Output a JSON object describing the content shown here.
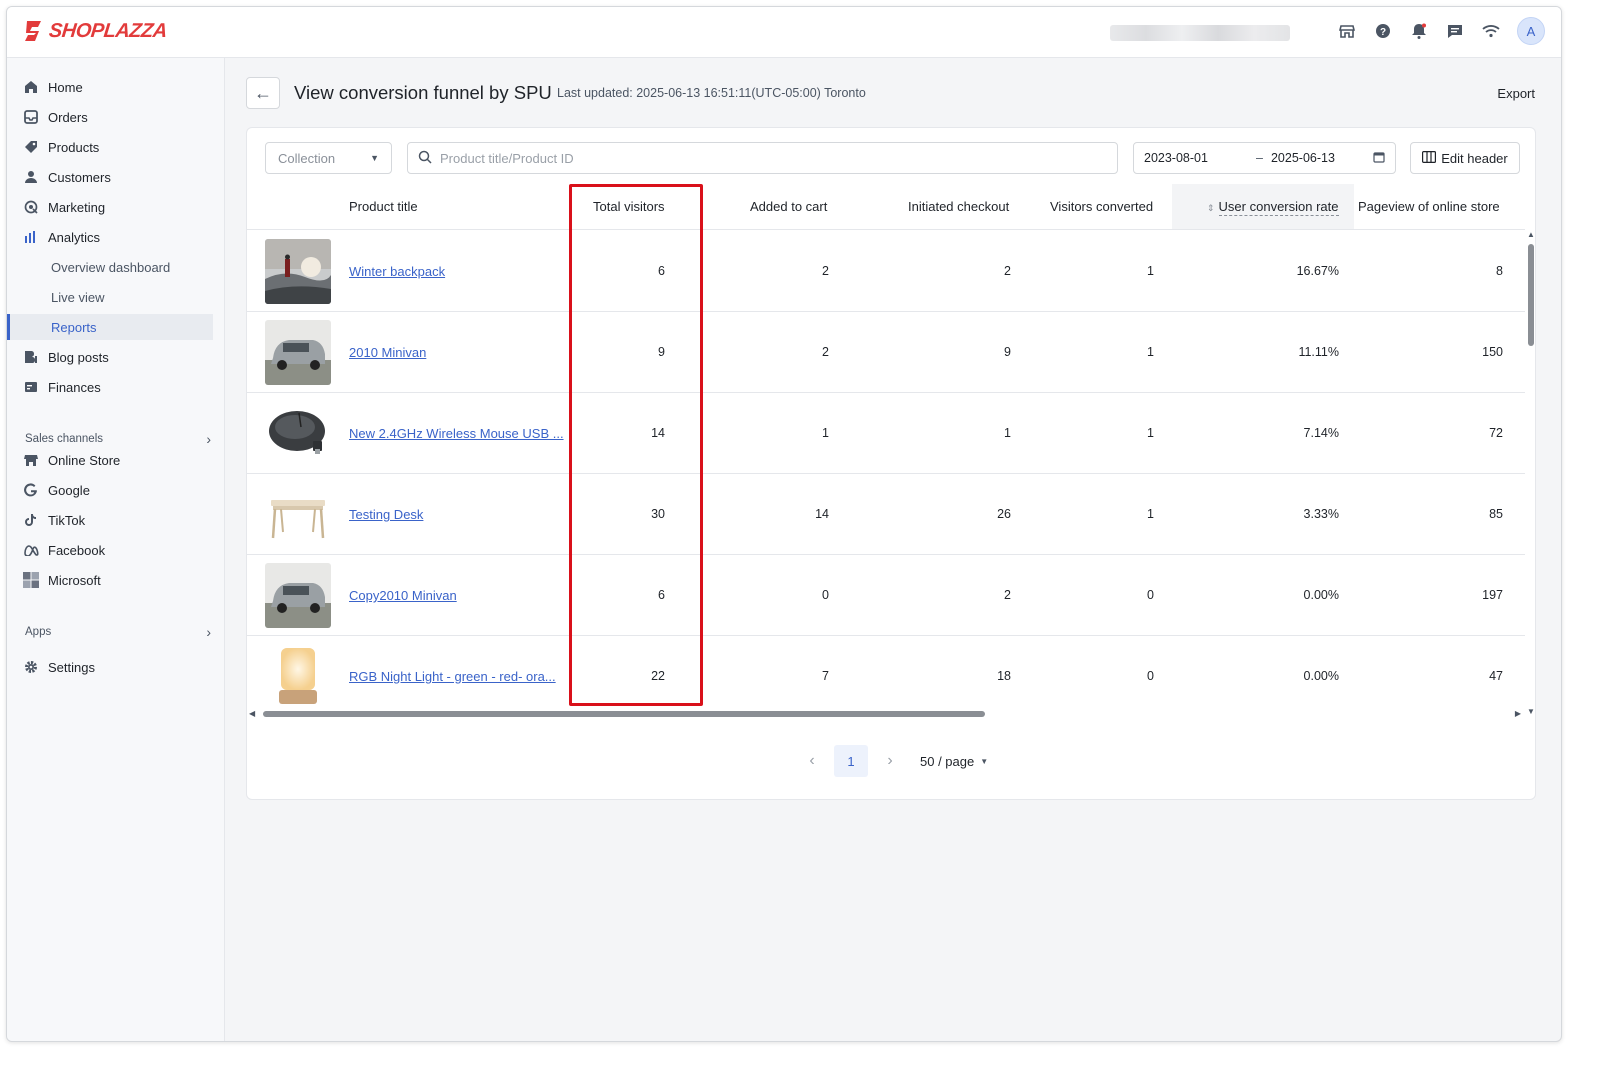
{
  "brand": {
    "name": "SHOPLAZZA",
    "color": "#e23b3b",
    "avatar_initial": "A"
  },
  "top_icons": [
    "store-icon",
    "help-icon",
    "bell-icon",
    "chat-icon",
    "wifi-icon"
  ],
  "sidebar": {
    "items": [
      {
        "label": "Home",
        "icon": "home-icon"
      },
      {
        "label": "Orders",
        "icon": "inbox-icon"
      },
      {
        "label": "Products",
        "icon": "tag-icon"
      },
      {
        "label": "Customers",
        "icon": "person-icon"
      },
      {
        "label": "Marketing",
        "icon": "target-icon"
      },
      {
        "label": "Analytics",
        "icon": "bar-chart-icon"
      },
      {
        "label": "Overview dashboard"
      },
      {
        "label": "Live view"
      },
      {
        "label": "Reports"
      },
      {
        "label": "Blog posts",
        "icon": "blog-icon"
      },
      {
        "label": "Finances",
        "icon": "finance-icon"
      }
    ],
    "sales_channels_label": "Sales channels",
    "channels": [
      {
        "label": "Online Store",
        "icon": "store-icon"
      },
      {
        "label": "Google",
        "icon": "google-icon"
      },
      {
        "label": "TikTok",
        "icon": "tiktok-icon"
      },
      {
        "label": "Facebook",
        "icon": "meta-icon"
      },
      {
        "label": "Microsoft",
        "icon": "microsoft-icon"
      }
    ],
    "apps_label": "Apps",
    "settings_label": "Settings"
  },
  "header": {
    "title": "View conversion funnel by SPU",
    "last_updated": "Last updated: 2025-06-13 16:51:11(UTC-05:00) Toronto",
    "export_label": "Export"
  },
  "filters": {
    "collection_placeholder": "Collection",
    "search_placeholder": "Product title/Product ID",
    "date_start": "2023-08-01",
    "date_end": "2025-06-13",
    "edit_header_label": "Edit header"
  },
  "table": {
    "columns": [
      "Product title",
      "Total visitors",
      "Added to cart",
      "Initiated checkout",
      "Visitors converted",
      "User conversion rate",
      "Pageview of online store"
    ],
    "sorted_column": "User conversion rate",
    "rows": [
      {
        "title": "Winter backpack",
        "total_visitors": "6",
        "added_to_cart": "2",
        "initiated_checkout": "2",
        "visitors_converted": "1",
        "conversion_rate": "16.67%",
        "pageviews": "8"
      },
      {
        "title": "2010 Minivan",
        "total_visitors": "9",
        "added_to_cart": "2",
        "initiated_checkout": "9",
        "visitors_converted": "1",
        "conversion_rate": "11.11%",
        "pageviews": "150"
      },
      {
        "title": "New 2.4GHz Wireless Mouse USB ...",
        "total_visitors": "14",
        "added_to_cart": "1",
        "initiated_checkout": "1",
        "visitors_converted": "1",
        "conversion_rate": "7.14%",
        "pageviews": "72"
      },
      {
        "title": "Testing Desk",
        "total_visitors": "30",
        "added_to_cart": "14",
        "initiated_checkout": "26",
        "visitors_converted": "1",
        "conversion_rate": "3.33%",
        "pageviews": "85"
      },
      {
        "title": "Copy2010 Minivan",
        "total_visitors": "6",
        "added_to_cart": "0",
        "initiated_checkout": "2",
        "visitors_converted": "0",
        "conversion_rate": "0.00%",
        "pageviews": "197"
      },
      {
        "title": "RGB Night Light - green - red- ora...",
        "total_visitors": "22",
        "added_to_cart": "7",
        "initiated_checkout": "18",
        "visitors_converted": "0",
        "conversion_rate": "0.00%",
        "pageviews": "47"
      }
    ]
  },
  "pagination": {
    "current_page": "1",
    "page_size": "50 / page"
  },
  "highlight_color": "#d9101a",
  "accent_color": "#3a63c9"
}
